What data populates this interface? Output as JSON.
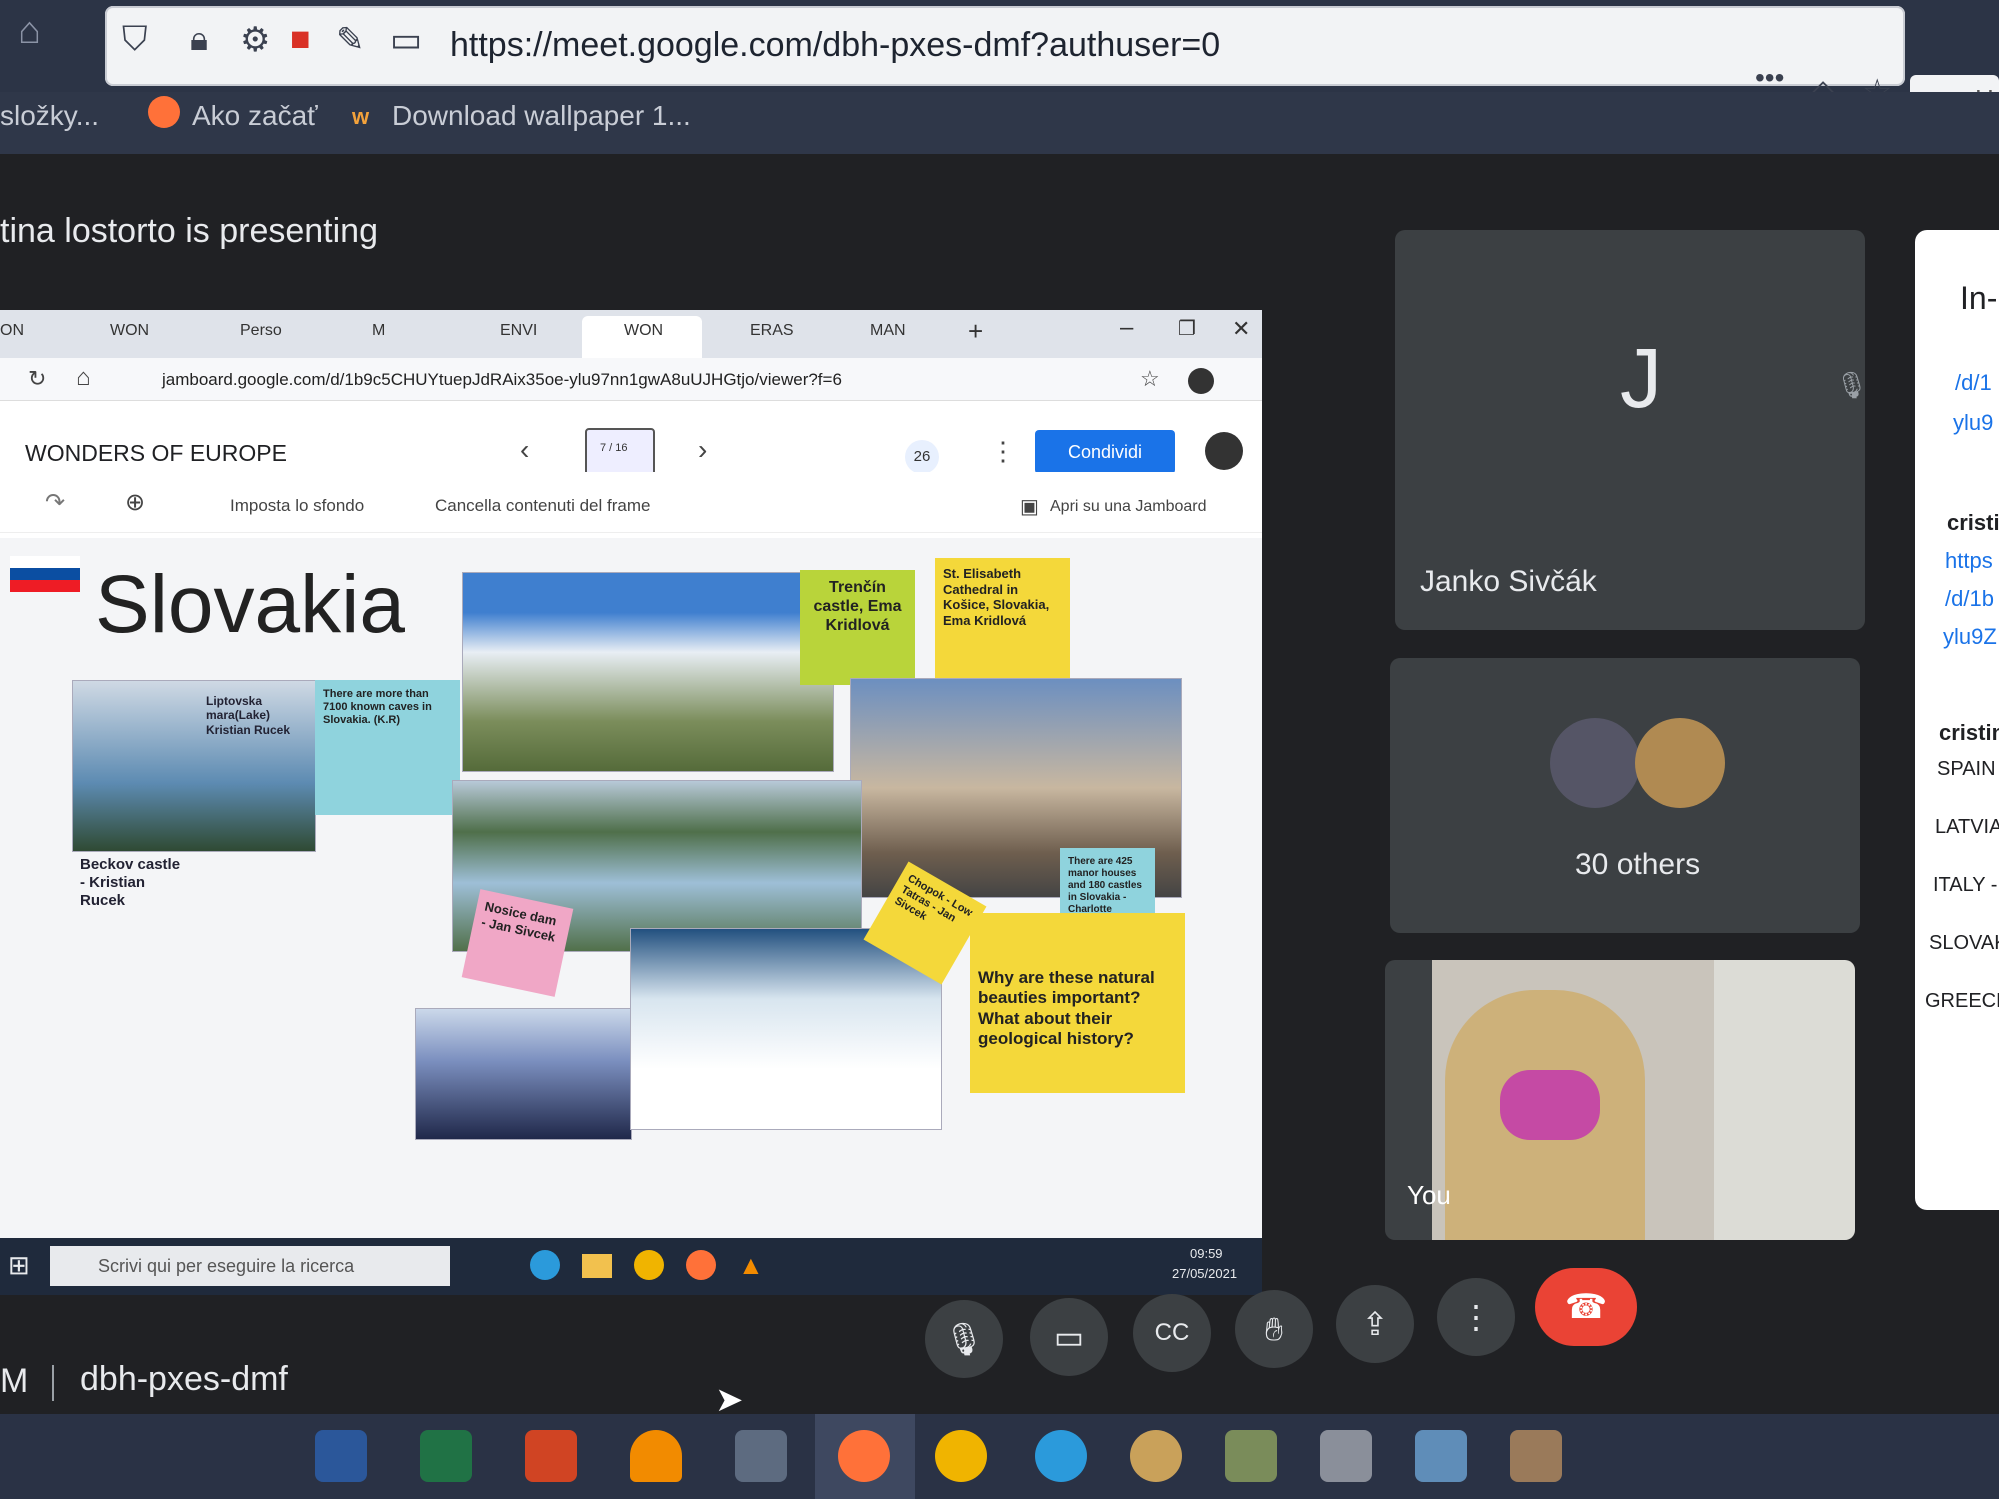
{
  "browser": {
    "url": "https://meet.google.com/dbh-pxes-dmf?authuser=0",
    "bookmarks": [
      "složky...",
      "Ako začať",
      "Download wallpaper 1..."
    ],
    "search_placeholder": "H"
  },
  "meet": {
    "presenting_text": "tina lostorto is presenting",
    "meeting_code": "dbh-pxes-dmf",
    "meeting_prefix": "M",
    "participants": {
      "janko": {
        "initial": "J",
        "name": "Janko Sivčák"
      },
      "others": {
        "label": "30 others"
      },
      "you": {
        "label": "You"
      }
    },
    "side_panel": {
      "heading": "In-",
      "links": [
        "/d/1",
        "ylu9",
        "https",
        "/d/1b",
        "ylu9Z"
      ],
      "authors": [
        "cristi",
        "cristin"
      ],
      "countries": [
        "SPAIN",
        "LATVIA",
        "ITALY -",
        "SLOVAK",
        "GREECE"
      ]
    }
  },
  "inner": {
    "tabs": [
      "ON",
      "WON",
      "Perso",
      "M",
      "ENVI",
      "WON",
      "ERAS",
      "MAN"
    ],
    "url": "jamboard.google.com/d/1b9c5CHUYtuepJdRAix35oe-ylu97nn1gwA8uUJHGtjo/viewer?f=6",
    "jamboard": {
      "title": "WONDERS OF EUROPE",
      "frame": "7 / 16",
      "count": "26",
      "share_label": "Condividi",
      "set_background": "Imposta lo sfondo",
      "clear_frame": "Cancella contenuti del frame",
      "open_in_jamboard": "Apri su una Jamboard"
    },
    "slide": {
      "title": "Slovakia",
      "notes": {
        "trencin": "Trenčín castle, Ema Kridlová",
        "elisabeth": "St. Elisabeth Cathedral in Košice, Slovakia, Ema Kridlová",
        "liptovska": "Liptovska mara(Lake) Kristian Rucek",
        "caves": "There are more than 7100 known caves in Slovakia. (K.R)",
        "beckov": "Beckov castle - Kristian Rucek",
        "novice": "Nosice dam - Jan Sivcek",
        "chopok": "Chopok - Low Tatras - Jan Sivcek",
        "manor": "There are 425 manor houses and 180 castles in Slovakia - Charlotte",
        "question": "Why are these natural beauties important? What about their geological history?"
      }
    },
    "taskbar": {
      "search": "Scrivi qui per eseguire la ricerca",
      "time": "09:59",
      "date": "27/05/2021"
    }
  },
  "colors": {
    "meet_bg": "#202124",
    "tile": "#3c4043",
    "share_blue": "#1a73e8",
    "end_call": "#ea4335",
    "note_green": "#b9d43a",
    "note_yellow": "#f4d83a",
    "note_cyan": "#8fd3dd",
    "note_pink": "#f0a7c6"
  }
}
